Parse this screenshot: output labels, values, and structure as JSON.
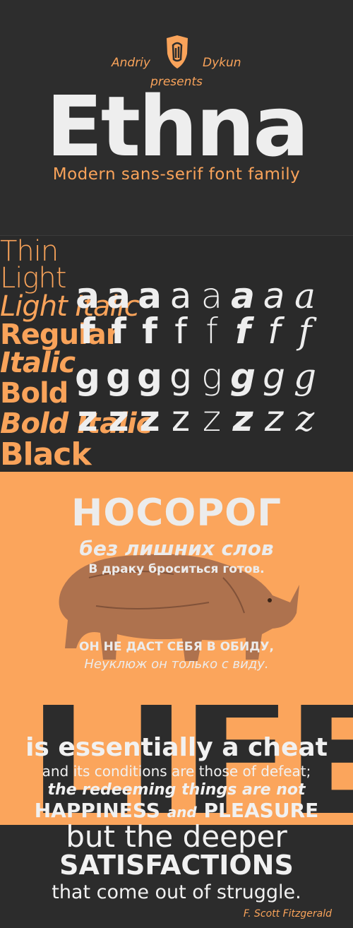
{
  "header": {
    "author_first": "Andriy",
    "author_last": "Dykun",
    "presents": "presents",
    "title": "Ethna",
    "tagline": "Modern sans-serif font family",
    "logo_icon": "shield-monogram-icon"
  },
  "weights": [
    "Thin",
    "Light",
    "Light Italic",
    "Regular",
    "Italic",
    "Bold",
    "Bold Italic",
    "Black"
  ],
  "glyphs": {
    "a": [
      "a",
      "a",
      "a",
      "a",
      "a",
      "a",
      "a",
      "a"
    ],
    "f": [
      "f",
      "f",
      "f",
      "f",
      "f",
      "f",
      "f",
      "f"
    ],
    "g": [
      "g",
      "g",
      "g",
      "g",
      "g",
      "g",
      "g",
      "g"
    ],
    "z": [
      "z",
      "z",
      "z",
      "z",
      "z",
      "z",
      "z",
      "z"
    ]
  },
  "russian": {
    "title": "НОСОРОГ",
    "line1": "без лишних слов",
    "line2": "В драку броситься готов.",
    "line3": "ОН НЕ ДАСТ СЕБЯ В ОБИДУ,",
    "line4": "Неуклюж он только с виду.",
    "image_icon": "rhinoceros-illustration"
  },
  "quote": {
    "background_word": "LIFE",
    "line1": "is essentially a cheat",
    "line2": "and its conditions are those of defeat;",
    "line3": "the redeeming things are not",
    "line4_a": "HAPPINESS",
    "line4_b": "and",
    "line4_c": "PLEASURE",
    "line5": "but the deeper",
    "line6": "SATISFACTIONS",
    "line7": "that come out of struggle.",
    "author": "F. Scott Fitzgerald"
  },
  "colors": {
    "dark": "#2b2b2b",
    "accent": "#f9a35a",
    "light": "#eeeeee"
  }
}
